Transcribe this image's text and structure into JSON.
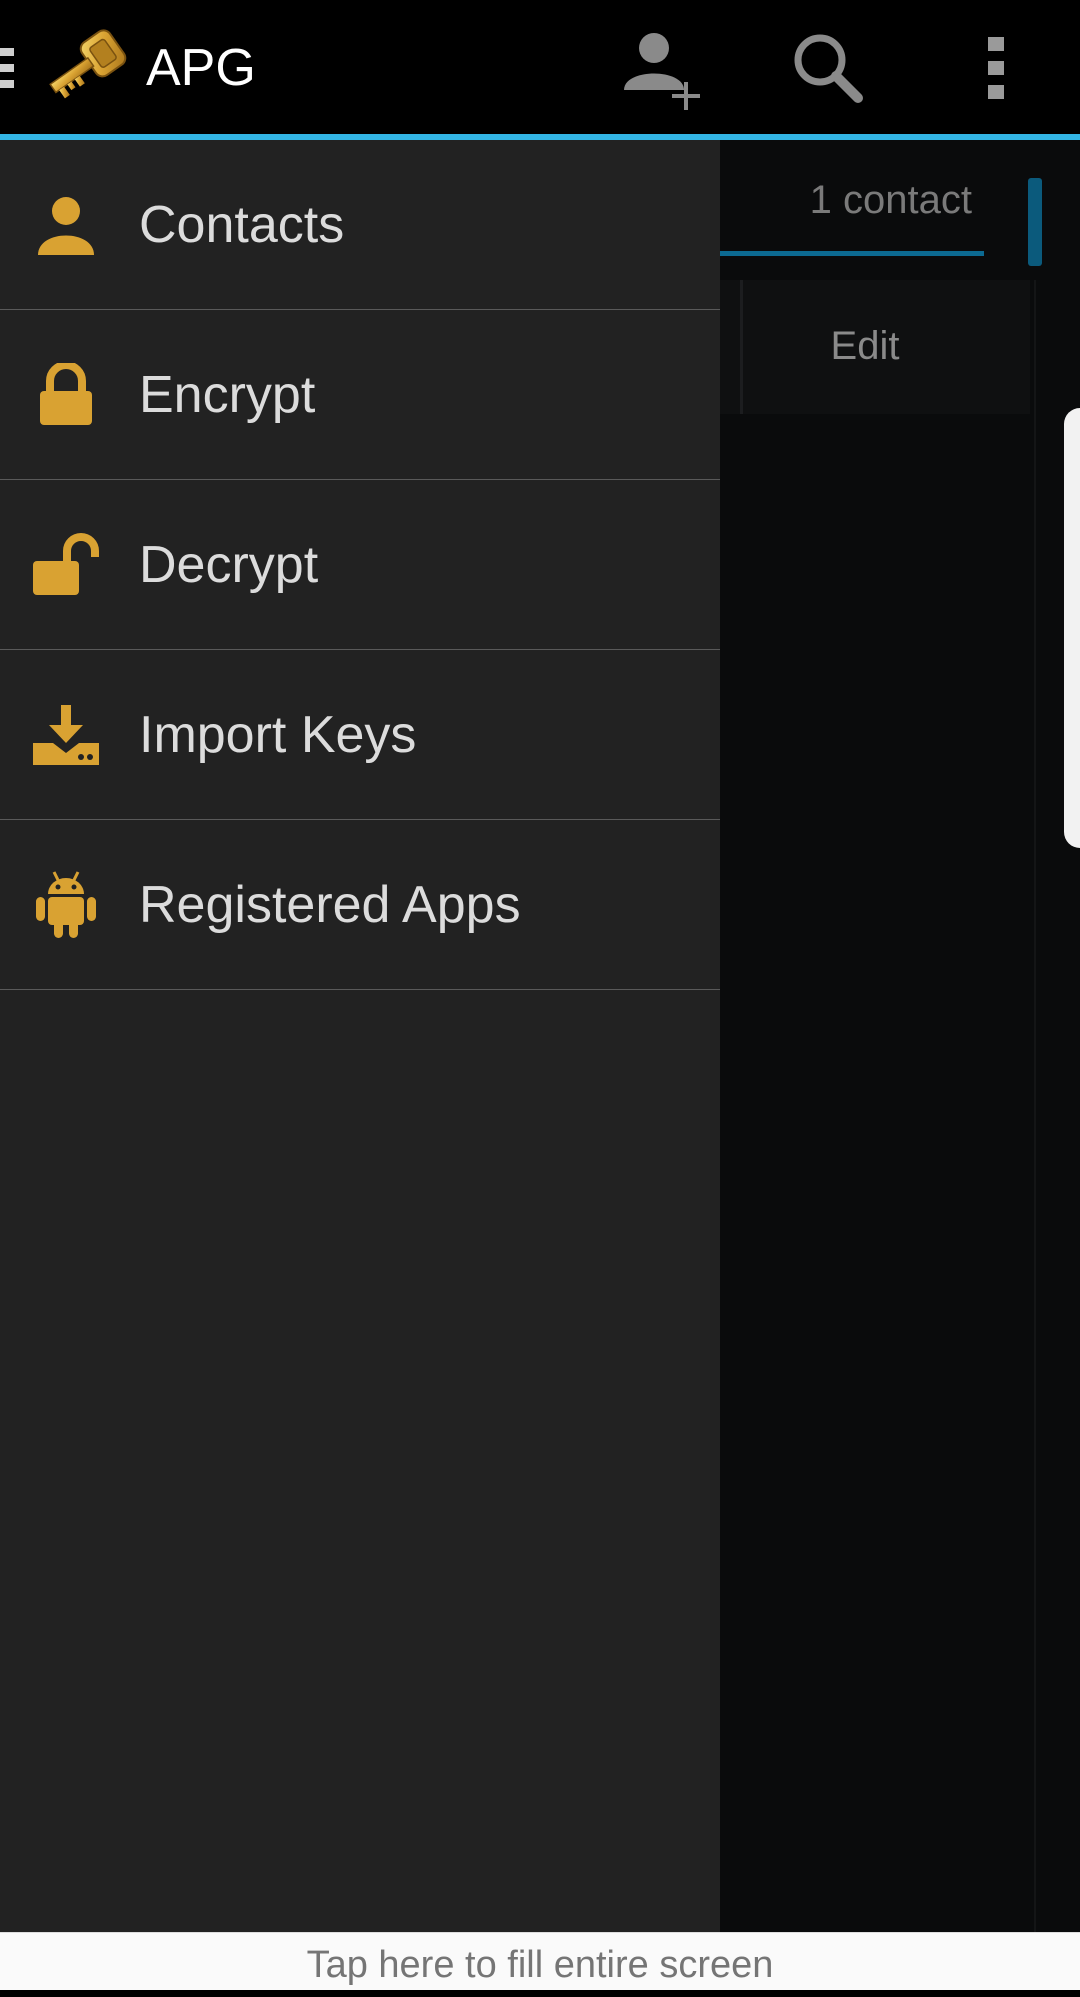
{
  "app": {
    "title": "APG",
    "accent_color": "#33b5e5",
    "icon_color": "#d9a232"
  },
  "action_bar": {
    "logo_icon": "golden-key-icon",
    "actions": [
      {
        "name": "add-contact",
        "icon": "person-add-icon"
      },
      {
        "name": "search",
        "icon": "search-icon"
      },
      {
        "name": "overflow",
        "icon": "overflow-menu-icon"
      }
    ]
  },
  "content": {
    "tab_label": "1 contact",
    "row_action": "Edit"
  },
  "drawer": {
    "items": [
      {
        "label": "Contacts",
        "icon": "person-icon"
      },
      {
        "label": "Encrypt",
        "icon": "lock-closed-icon"
      },
      {
        "label": "Decrypt",
        "icon": "lock-open-icon"
      },
      {
        "label": "Import Keys",
        "icon": "download-icon"
      },
      {
        "label": "Registered Apps",
        "icon": "android-icon"
      }
    ]
  },
  "bottom_bar": {
    "text": "Tap here to fill entire screen"
  }
}
